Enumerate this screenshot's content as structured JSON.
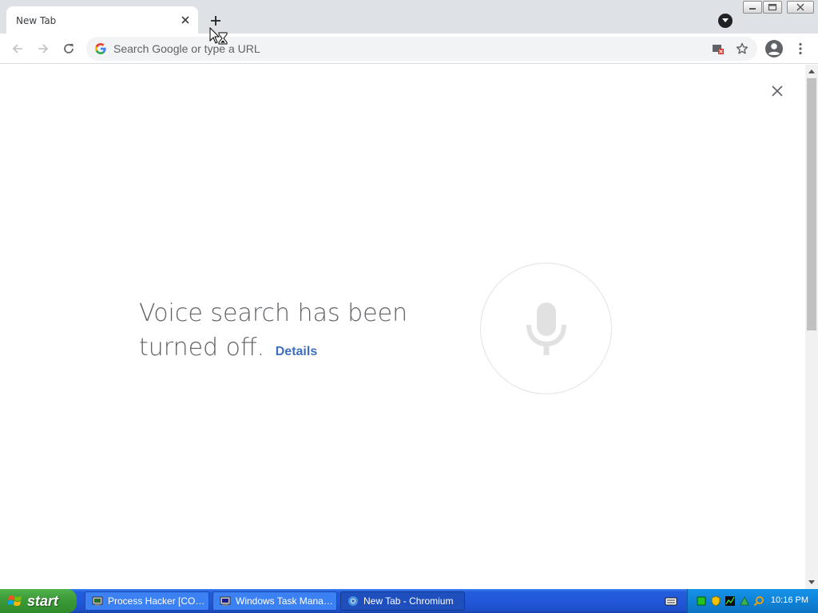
{
  "browser": {
    "tab": {
      "title": "New Tab",
      "close_icon": "close-icon"
    },
    "new_tab_icon": "plus-icon",
    "window_controls": {
      "minimize": "minimize-icon",
      "maximize": "maximize-icon",
      "close": "close-icon"
    },
    "toolbar": {
      "back_icon": "arrow-left-icon",
      "forward_icon": "arrow-right-icon",
      "reload_icon": "reload-icon",
      "omnibox": {
        "placeholder": "Search Google or type a URL",
        "value": ""
      },
      "blocked_icon": "popup-blocked-icon",
      "bookmark_icon": "star-icon",
      "profile_icon": "account-icon",
      "menu_icon": "vertical-dots-icon"
    }
  },
  "voice_search": {
    "message": "Voice search has been turned off.",
    "details_link": "Details",
    "close_icon": "close-icon",
    "mic_icon": "microphone-icon"
  },
  "taskbar": {
    "start_label": "start",
    "tasks": [
      {
        "label": "Process Hacker [COL...",
        "icon": "process-hacker-icon",
        "active": false
      },
      {
        "label": "Windows Task Manager",
        "icon": "task-manager-icon",
        "active": false
      },
      {
        "label": "New Tab - Chromium",
        "icon": "chromium-icon",
        "active": true
      }
    ],
    "clock": "10:16 PM"
  },
  "colors": {
    "tab_strip": "#dee1e6",
    "link": "#3f6fbf",
    "taskbar_blue": "#245edb",
    "start_green": "#3c9a38",
    "tray_blue": "#0f84d8"
  }
}
